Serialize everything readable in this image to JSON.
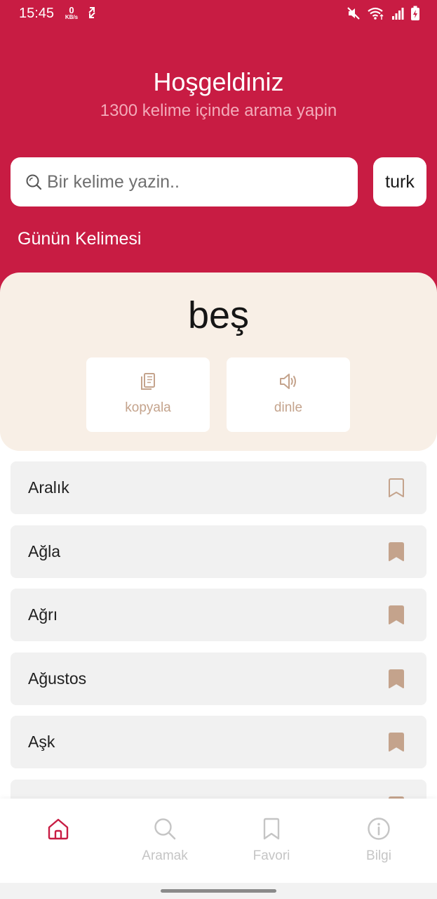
{
  "status_bar": {
    "time": "15:45",
    "net_speed_value": "0",
    "net_speed_unit": "KB/s"
  },
  "header": {
    "title": "Hoşgeldiniz",
    "subtitle": "1300 kelime içinde arama yapin"
  },
  "search": {
    "placeholder": "Bir kelime yazin..",
    "value": ""
  },
  "language_button": "turk",
  "word_of_the_day": {
    "label": "Günün Kelimesi",
    "word": "beş",
    "copy_label": "kopyala",
    "listen_label": "dinle"
  },
  "word_list": [
    {
      "word": "Aralık",
      "bookmarked": false
    },
    {
      "word": "Ağla",
      "bookmarked": true
    },
    {
      "word": "Ağrı",
      "bookmarked": true
    },
    {
      "word": "Ağustos",
      "bookmarked": true
    },
    {
      "word": "Aşk",
      "bookmarked": true
    }
  ],
  "bottom_nav": {
    "home": "",
    "search": "Aramak",
    "favorites": "Favori",
    "info": "Bilgi"
  },
  "colors": {
    "brand": "#c81c43",
    "card_bg": "#f8efe6",
    "accent_tan": "#c4a38c",
    "row_bg": "#f1f1f1"
  }
}
